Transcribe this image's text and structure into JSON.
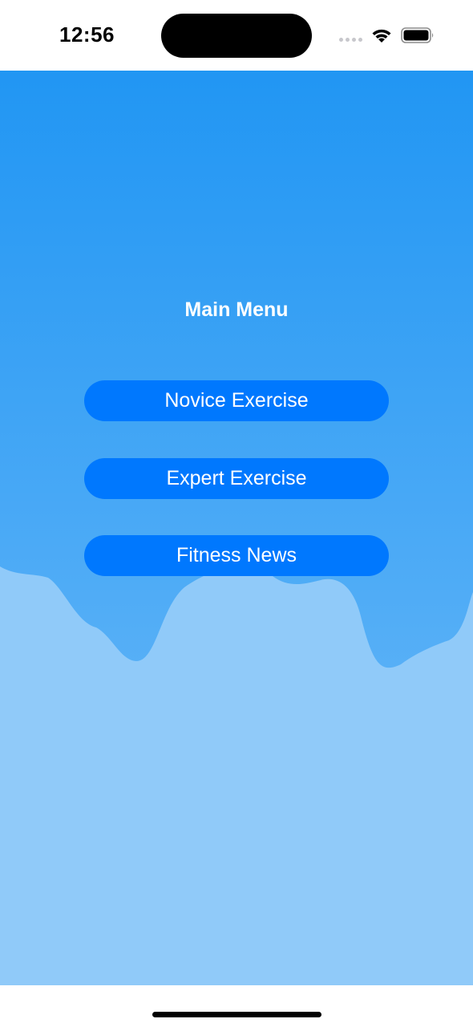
{
  "status_bar": {
    "time": "12:56"
  },
  "colors": {
    "gradient_top": "#2196f3",
    "gradient_bottom": "#5ab1f7",
    "wave_fill": "#90caf9",
    "button_bg": "#0078fe",
    "button_text": "#ffffff"
  },
  "main_menu": {
    "title": "Main Menu",
    "buttons": [
      {
        "label": "Novice Exercise"
      },
      {
        "label": "Expert Exercise"
      },
      {
        "label": "Fitness News"
      }
    ]
  },
  "icons": {
    "wifi": "wifi-icon",
    "battery": "battery-icon",
    "signal": "signal-icon"
  }
}
